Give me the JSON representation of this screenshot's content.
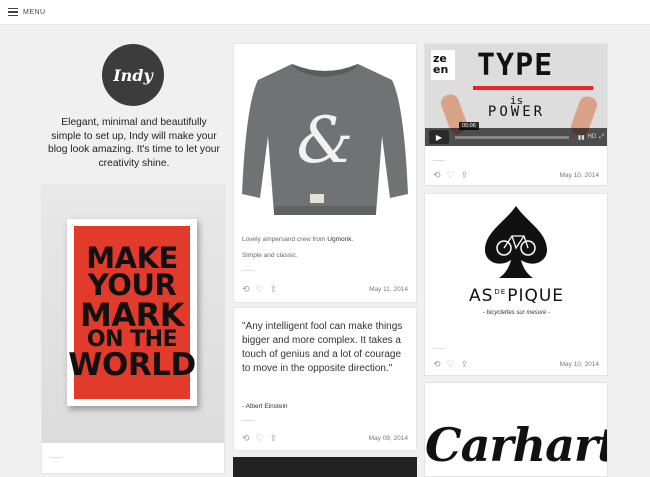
{
  "topbar": {
    "menu_label": "MENU"
  },
  "profile": {
    "avatar_text": "Indy",
    "bio": "Elegant, minimal and beautifully simple to set up, Indy will make your blog look amazing. It's time to let your creativity shine."
  },
  "poster": {
    "lines": [
      "MAKE",
      "YOUR",
      "MARK",
      "ON THE",
      "WORLD"
    ]
  },
  "sweater_post": {
    "caption_prefix": "Lovely ampersand crew from ",
    "caption_link": "Ugmonk",
    "caption_suffix": ".",
    "caption2": "Simple and classic.",
    "date": "May 11, 2014"
  },
  "quote_post": {
    "quote": "\"Any intelligent fool can make things bigger and more complex. It takes a touch of genius and a lot of courage to move in the opposite direction.\"",
    "author": "- Albert Einstein",
    "date": "May 09, 2014"
  },
  "video_post": {
    "logo_line1": "ze",
    "logo_line2": "en",
    "title_line1": "TYPE",
    "title_line2": "is",
    "title_line3": "POWER",
    "timecode": "05:06",
    "hd_label": "HD",
    "date": "May 10, 2014"
  },
  "spade_post": {
    "title_left": "AS",
    "title_de": "DE",
    "title_right": "PIQUE",
    "subtitle": "- bicyclettes sur mesure -",
    "date": "May 10, 2014"
  },
  "carhartt_post": {
    "logo_text": "Carhartt"
  },
  "icons": {
    "reblog": "reblog-icon",
    "like": "heart-icon",
    "share": "share-icon"
  }
}
